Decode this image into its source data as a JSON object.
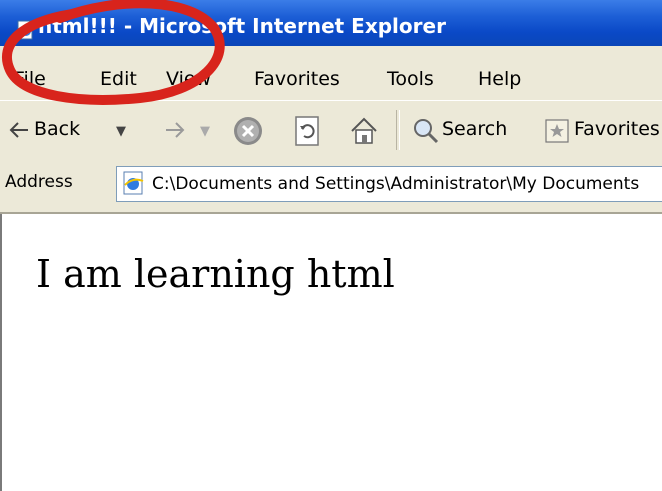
{
  "window": {
    "title": "html!!! - Microsoft Internet Explorer",
    "icon": "ie-page-icon"
  },
  "menu": {
    "items": [
      "File",
      "Edit",
      "View",
      "Favorites",
      "Tools",
      "Help"
    ]
  },
  "toolbar": {
    "back_label": "Back",
    "search_label": "Search",
    "favorites_label": "Favorites",
    "icons": [
      "back-arrow-icon",
      "forward-arrow-icon",
      "stop-icon",
      "refresh-icon",
      "home-icon",
      "search-icon",
      "favorites-icon"
    ]
  },
  "address": {
    "label": "Address",
    "value": "C:\\Documents and Settings\\Administrator\\My Documents"
  },
  "page": {
    "text": "I am learning html"
  },
  "annotation": {
    "color": "#d8241c"
  }
}
